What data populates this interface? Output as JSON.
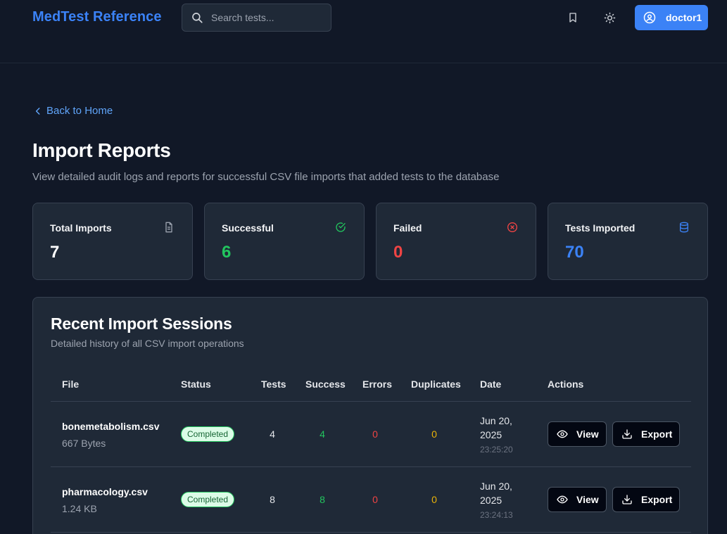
{
  "header": {
    "brand": "MedTest Reference",
    "search_placeholder": "Search tests...",
    "username": "doctor1"
  },
  "nav": {
    "back_label": "Back to Home"
  },
  "page": {
    "title": "Import Reports",
    "subtitle": "View detailed audit logs and reports for successful CSV file imports that added tests to the database"
  },
  "stats": [
    {
      "label": "Total Imports",
      "value": "7",
      "icon": "file-text-icon",
      "color": "#ffffff"
    },
    {
      "label": "Successful",
      "value": "6",
      "icon": "check-circle-icon",
      "color": "#22c55e"
    },
    {
      "label": "Failed",
      "value": "0",
      "icon": "x-circle-icon",
      "color": "#ef4444"
    },
    {
      "label": "Tests Imported",
      "value": "70",
      "icon": "database-icon",
      "color": "#3b82f6"
    }
  ],
  "sessions": {
    "title": "Recent Import Sessions",
    "subtitle": "Detailed history of all CSV import operations",
    "columns": [
      "File",
      "Status",
      "Tests",
      "Success",
      "Errors",
      "Duplicates",
      "Date",
      "Actions"
    ],
    "rows": [
      {
        "file": "bonemetabolism.csv",
        "size": "667 Bytes",
        "status": "Completed",
        "tests": "4",
        "success": "4",
        "errors": "0",
        "duplicates": "0",
        "date_line1": "Jun 20,",
        "date_line2": "2025",
        "time": "23:25:20",
        "view_label": "View",
        "export_label": "Export"
      },
      {
        "file": "pharmacology.csv",
        "size": "1.24 KB",
        "status": "Completed",
        "tests": "8",
        "success": "8",
        "errors": "0",
        "duplicates": "0",
        "date_line1": "Jun 20,",
        "date_line2": "2025",
        "time": "23:24:13",
        "view_label": "View",
        "export_label": "Export"
      }
    ]
  },
  "colors": {
    "background": "#111827",
    "card": "#1f2937",
    "accent": "#3b82f6",
    "success": "#22c55e",
    "error": "#ef4444",
    "warning": "#eab308"
  }
}
